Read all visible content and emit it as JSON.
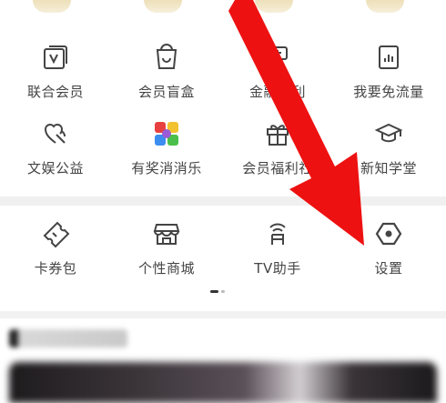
{
  "grid": {
    "row1": [
      {
        "label": "联合会员",
        "icon": "joint-membership-icon"
      },
      {
        "label": "会员盲盒",
        "icon": "blind-box-icon"
      },
      {
        "label": "金融福利",
        "icon": "finance-welfare-icon"
      },
      {
        "label": "我要免流量",
        "icon": "free-data-icon"
      }
    ],
    "row2": [
      {
        "label": "文娱公益",
        "icon": "charity-heart-icon"
      },
      {
        "label": "有奖消消乐",
        "icon": "match-game-icon"
      },
      {
        "label": "会员福利社",
        "icon": "gift-icon"
      },
      {
        "label": "新知学堂",
        "icon": "graduation-cap-icon"
      }
    ],
    "row3": [
      {
        "label": "卡券包",
        "icon": "ticket-icon"
      },
      {
        "label": "个性商城",
        "icon": "store-icon"
      },
      {
        "label": "TV助手",
        "icon": "tv-broadcast-icon"
      },
      {
        "label": "设置",
        "icon": "settings-hexagon-icon"
      }
    ]
  },
  "pager": {
    "current": 1,
    "total": 2
  },
  "colors": {
    "icon": "#444444",
    "arrow": "#ee1111",
    "accent_yellow": "#f2c230"
  }
}
